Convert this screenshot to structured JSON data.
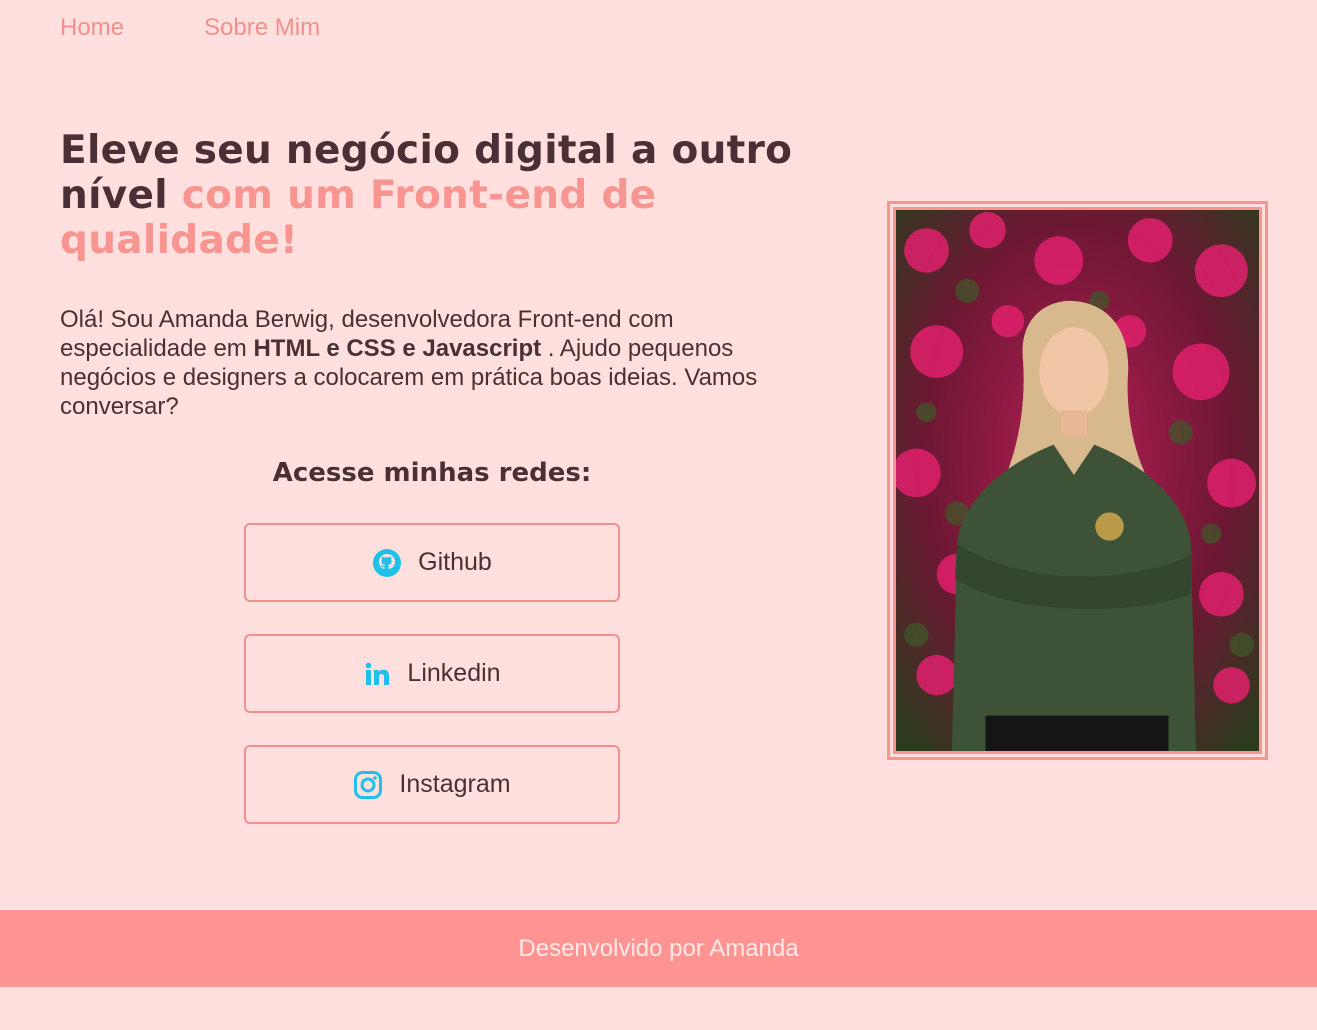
{
  "nav": {
    "home": "Home",
    "about": "Sobre Mim"
  },
  "hero": {
    "headline_plain": "Eleve seu negócio digital a outro nível ",
    "headline_accent": "com um Front-end de qualidade!",
    "intro_start": "Olá! Sou Amanda Berwig, desenvolvedora Front-end com especialidade em ",
    "intro_strong": "HTML e CSS e Javascript",
    "intro_end": " . Ajudo pequenos negócios e designers a colocarem em prática boas ideias. Vamos conversar?"
  },
  "networks": {
    "title": "Acesse minhas redes:",
    "links": [
      {
        "label": "Github",
        "icon": "github-icon"
      },
      {
        "label": "Linkedin",
        "icon": "linkedin-icon"
      },
      {
        "label": "Instagram",
        "icon": "instagram-icon"
      }
    ]
  },
  "profile_photo": {
    "subject": "portrait photo"
  },
  "footer": {
    "text": "Desenvolvido por Amanda"
  },
  "colors": {
    "background": "#FFE0DE",
    "accent": "#F99590",
    "text": "#4A3034",
    "icon": "#1FC0EA",
    "footer_bg": "#FF9493"
  }
}
